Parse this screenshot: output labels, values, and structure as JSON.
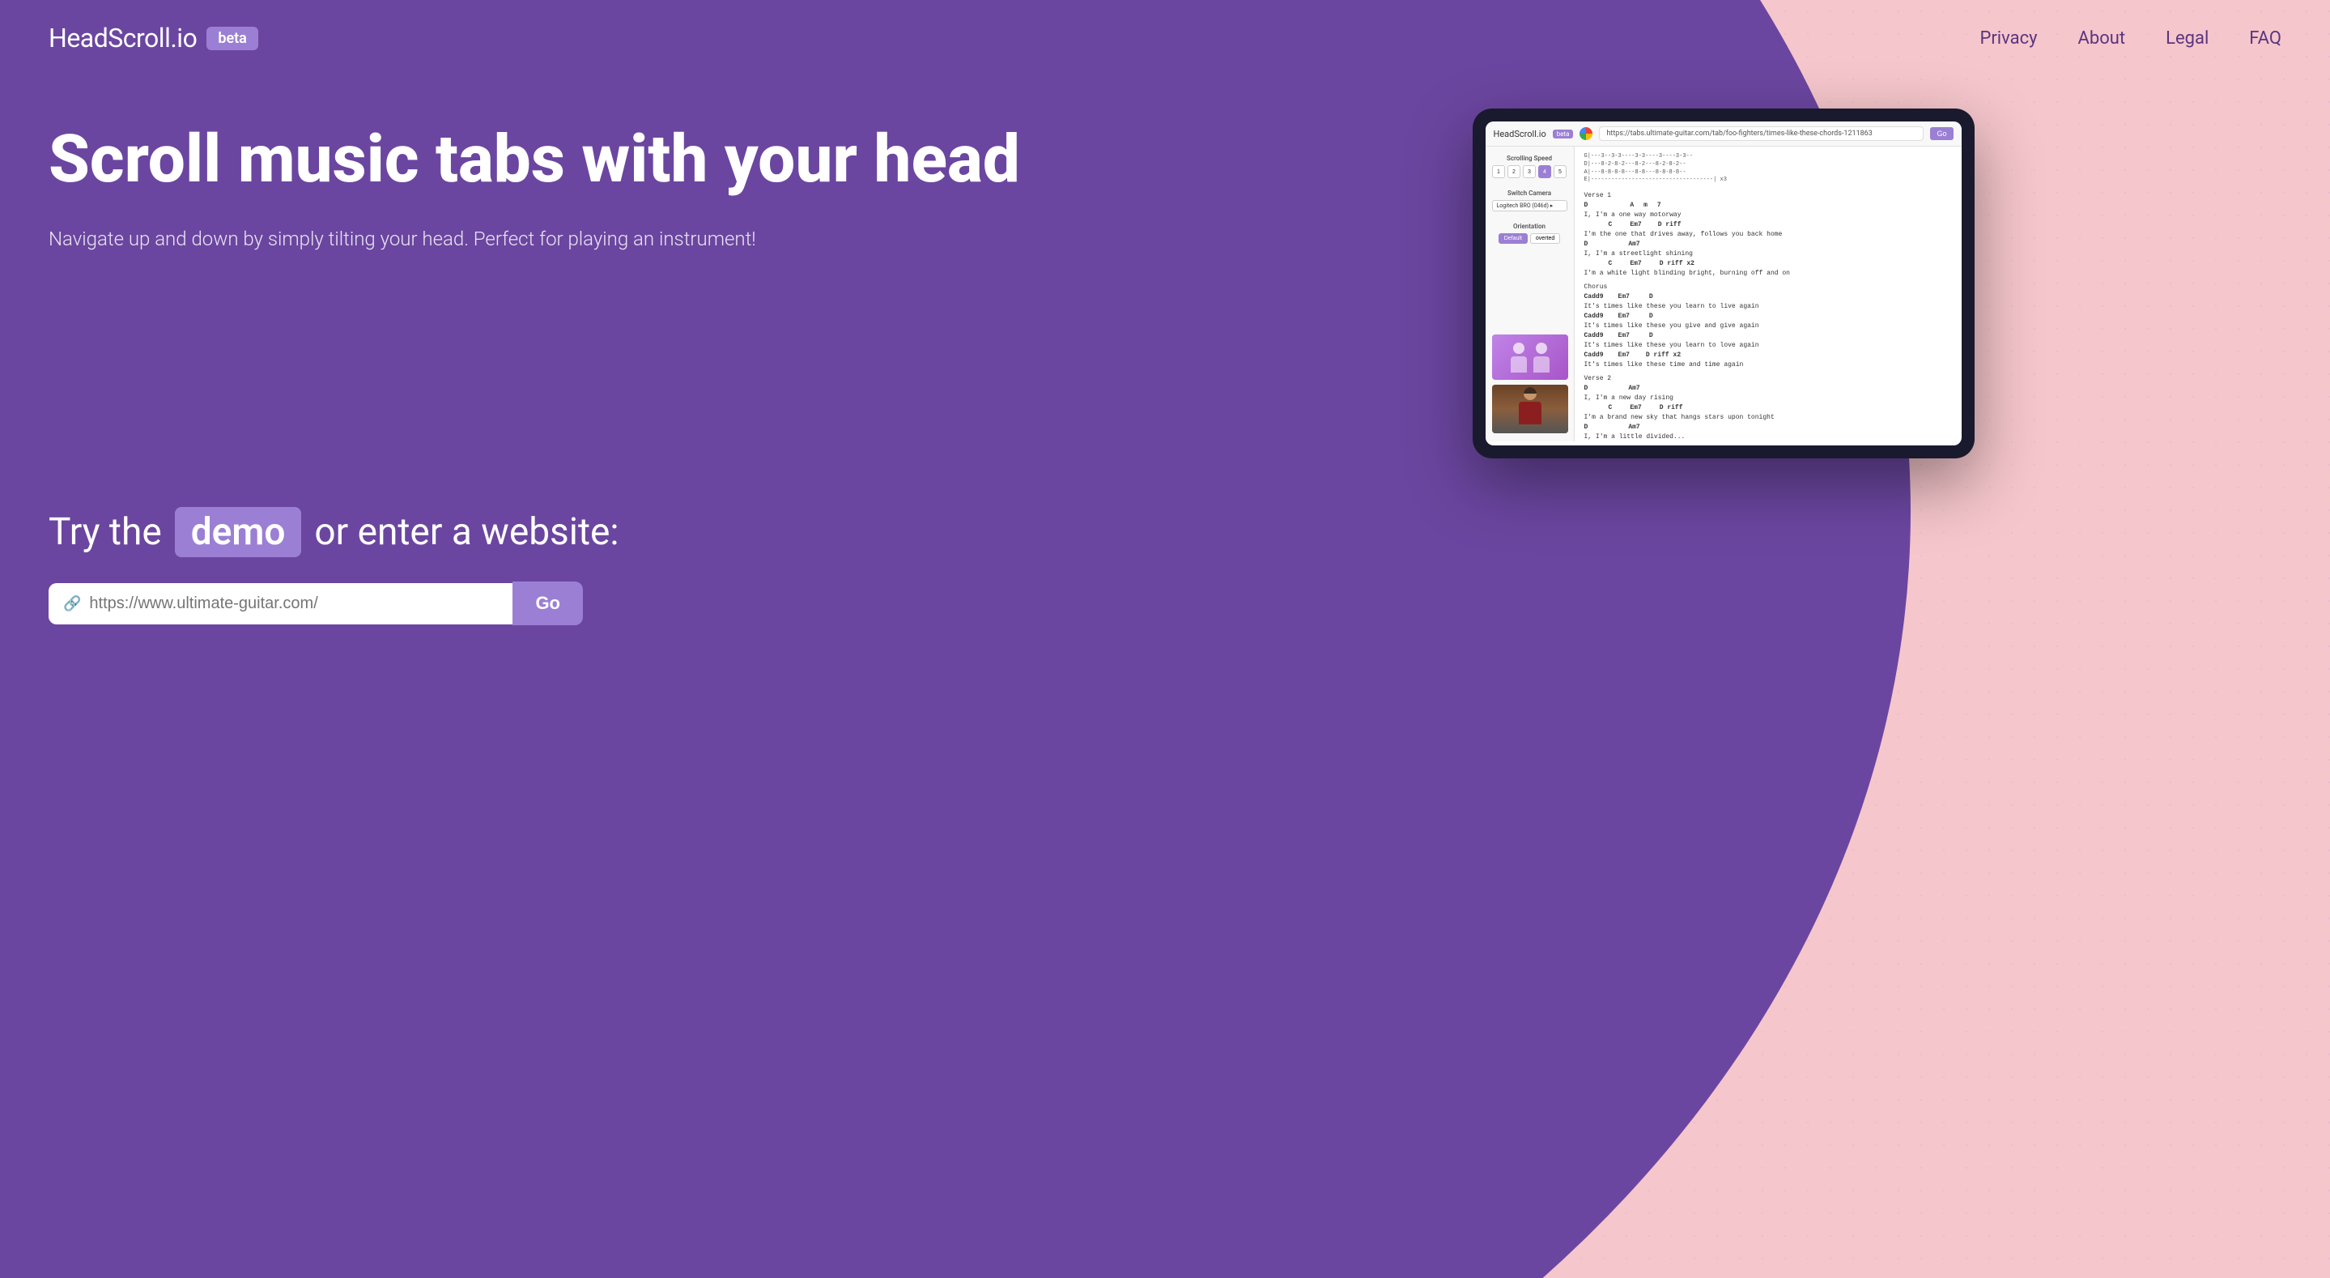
{
  "logo": {
    "text": "HeadScroll.io",
    "badge": "beta"
  },
  "nav": {
    "links": [
      {
        "label": "Privacy",
        "href": "#"
      },
      {
        "label": "About",
        "href": "#"
      },
      {
        "label": "Legal",
        "href": "#"
      },
      {
        "label": "FAQ",
        "href": "#"
      }
    ]
  },
  "hero": {
    "title": "Scroll music tabs with your head",
    "subtitle": "Navigate up and down by simply tilting your head.\nPerfect for playing an instrument!",
    "tablet": {
      "logo": "HeadScroll.io",
      "beta": "beta",
      "url": "https://tabs.ultimate-guitar.com/tab/foo-fighters/times-like-these-chords-1211863",
      "go_label": "Go",
      "sidebar": {
        "scrolling_speed_label": "Scrolling Speed",
        "speed_buttons": [
          "1",
          "2",
          "3",
          "4",
          "5"
        ],
        "active_speed": 4,
        "switch_camera_label": "Switch Camera",
        "camera_value": "Logitech BRO (046d) ▸",
        "orientation_label": "Orientation",
        "orientation_options": [
          "Default",
          "overted"
        ],
        "active_orientation": "Default"
      },
      "tab_code": "G|--3--3-3---3-3--|--3---3-----3--3-3--|\nD|---8-2-8-2---8-2---8-2-8-2--|\nA|---8-8-8-8---8-8---8-8-8-8--|\nE|----------------------------------| x3",
      "lyrics": [
        {
          "type": "section",
          "text": "Verse 1"
        },
        {
          "type": "chord-line",
          "chords": [
            {
              "text": "D",
              "pos": 0
            },
            {
              "text": "Am7",
              "pos": 20
            }
          ]
        },
        {
          "type": "lyric",
          "text": "I, I'm a one way motorway"
        },
        {
          "type": "chord-line",
          "chords": [
            {
              "text": "C",
              "pos": 14
            },
            {
              "text": "Em7",
              "pos": 26
            },
            {
              "text": "D riff",
              "pos": 40
            }
          ]
        },
        {
          "type": "lyric",
          "text": "I'm the one that drives away, follows you back home"
        },
        {
          "type": "chord-line",
          "chords": [
            {
              "text": "D",
              "pos": 0
            },
            {
              "text": "Am7",
              "pos": 20
            }
          ]
        },
        {
          "type": "lyric",
          "text": "I, I'm a streetlight shining"
        },
        {
          "type": "chord-line",
          "chords": [
            {
              "text": "C",
              "pos": 14
            },
            {
              "text": "Em7",
              "pos": 26
            },
            {
              "text": "D riff x2",
              "pos": 40
            }
          ]
        },
        {
          "type": "lyric",
          "text": "I'm a white light blinding bright, burning off and on"
        },
        {
          "type": "blank"
        },
        {
          "type": "section",
          "text": "Chorus"
        },
        {
          "type": "chord-line",
          "chords": [
            {
              "text": "Cadd9",
              "pos": 0
            },
            {
              "text": "Em7",
              "pos": 18
            },
            {
              "text": "D",
              "pos": 34
            }
          ]
        },
        {
          "type": "lyric",
          "text": "It's times like these you learn to live again"
        },
        {
          "type": "chord-line",
          "chords": [
            {
              "text": "Cadd9",
              "pos": 0
            },
            {
              "text": "Em7",
              "pos": 18
            },
            {
              "text": "D",
              "pos": 34
            }
          ]
        },
        {
          "type": "lyric",
          "text": "It's times like these you give and give again"
        },
        {
          "type": "chord-line",
          "chords": [
            {
              "text": "Cadd9",
              "pos": 0
            },
            {
              "text": "Em7",
              "pos": 18
            },
            {
              "text": "D",
              "pos": 34
            }
          ]
        },
        {
          "type": "lyric",
          "text": "It's times like these you learn to love again"
        },
        {
          "type": "chord-line",
          "chords": [
            {
              "text": "Cadd9",
              "pos": 0
            },
            {
              "text": "Em7",
              "pos": 18
            },
            {
              "text": "D riff x2",
              "pos": 34
            }
          ]
        },
        {
          "type": "lyric",
          "text": "It's times like these time and time again"
        },
        {
          "type": "blank"
        },
        {
          "type": "section",
          "text": "Verse 2"
        },
        {
          "type": "chord-line",
          "chords": [
            {
              "text": "D",
              "pos": 0
            },
            {
              "text": "Am7",
              "pos": 20
            }
          ]
        },
        {
          "type": "lyric",
          "text": "I, I'm a new day rising"
        },
        {
          "type": "chord-line",
          "chords": [
            {
              "text": "C",
              "pos": 14
            },
            {
              "text": "Em7",
              "pos": 26
            },
            {
              "text": "D riff",
              "pos": 40
            }
          ]
        },
        {
          "type": "lyric",
          "text": "I'm a brand new sky that hangs stars upon tonight"
        },
        {
          "type": "chord-line",
          "chords": [
            {
              "text": "D",
              "pos": 0
            },
            {
              "text": "Am7",
              "pos": 20
            }
          ]
        },
        {
          "type": "lyric",
          "text": "I, I'm a little divided..."
        }
      ]
    }
  },
  "cta": {
    "prefix": "Try the",
    "demo_label": "demo",
    "suffix": "or enter a website:",
    "input_placeholder": "https://www.ultimate-guitar.com/",
    "go_label": "Go"
  },
  "colors": {
    "purple": "#6b46a0",
    "purple_light": "#9b7fd4",
    "pink_bg": "#f5c6cb",
    "text_white": "#ffffff"
  }
}
